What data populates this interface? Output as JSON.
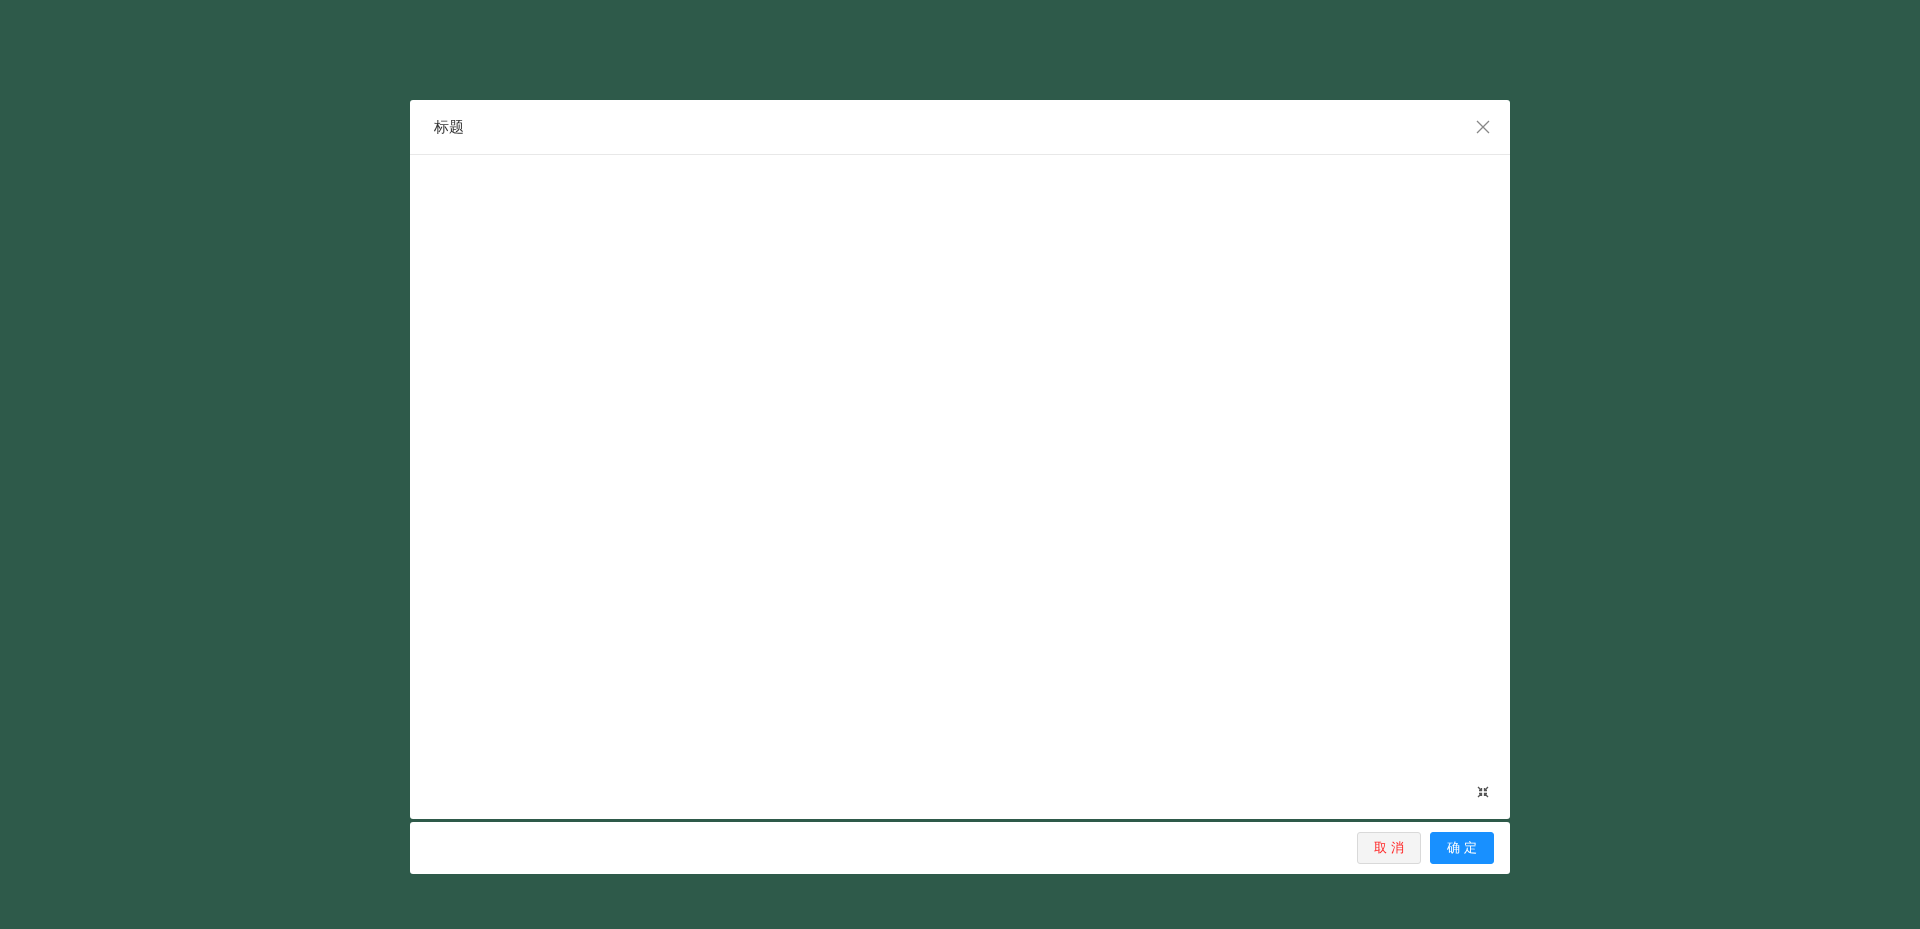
{
  "dialog": {
    "title": "标题"
  },
  "footer": {
    "buttons": [
      {
        "label": "取 消",
        "kind": "cancel"
      },
      {
        "label": "确 定",
        "kind": "primary"
      }
    ]
  }
}
